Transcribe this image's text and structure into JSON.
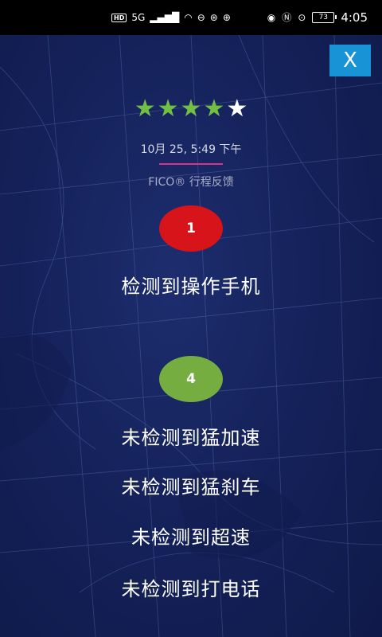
{
  "status_bar": {
    "hd": "HD",
    "network": "5G",
    "battery": "73",
    "time": "4:05"
  },
  "close_label": "X",
  "rating": {
    "value": 4,
    "max": 5
  },
  "trip": {
    "datetime": "10月 25, 5:49 下午",
    "feedback_title": "FICO® 行程反馈"
  },
  "detected": {
    "count": "1",
    "events": [
      "检测到操作手机"
    ]
  },
  "not_detected": {
    "count": "4",
    "events": [
      "未检测到猛加速",
      "未检测到猛刹车",
      "未检测到超速",
      "未检测到打电话"
    ]
  },
  "colors": {
    "accent_blue": "#1793d6",
    "star_green": "#72c043",
    "bad_red": "#d8141b",
    "good_green": "#75ad41",
    "divider_pink": "#d8348a"
  }
}
